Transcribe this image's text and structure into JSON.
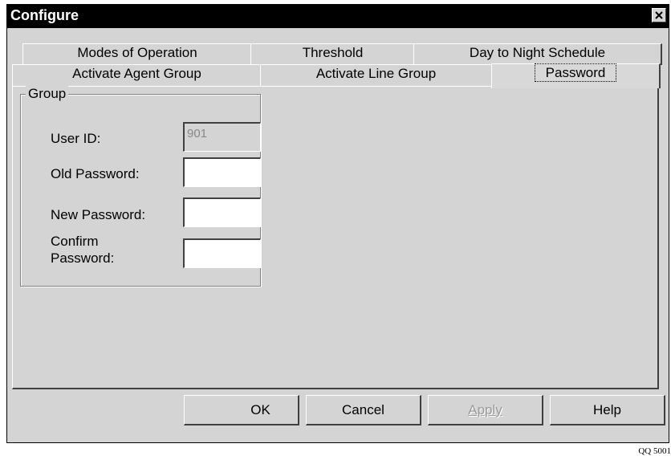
{
  "window": {
    "title": "Configure"
  },
  "tabs": {
    "back_row": [
      {
        "label": "Modes of Operation"
      },
      {
        "label": "Threshold"
      },
      {
        "label": "Day to Night Schedule"
      }
    ],
    "front_row": [
      {
        "label": "Activate Agent Group"
      },
      {
        "label": "Activate Line Group"
      },
      {
        "label": "Password",
        "selected": true
      }
    ]
  },
  "group": {
    "label": "Group",
    "user_id_label": "User ID:",
    "user_id_value": "901",
    "old_password_label": "Old Password:",
    "old_password_value": "",
    "new_password_label": "New Password:",
    "new_password_value": "",
    "confirm_password_label_line1": "Confirm",
    "confirm_password_label_line2": "Password:",
    "confirm_password_value": ""
  },
  "buttons": {
    "ok": "OK",
    "cancel": "Cancel",
    "apply": "Apply",
    "help": "Help"
  },
  "figure_id": "QQ 5001"
}
